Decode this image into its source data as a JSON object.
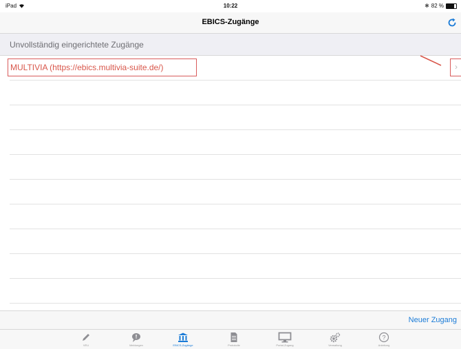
{
  "status_bar": {
    "device": "iPad",
    "time": "10:22",
    "battery": "82 %",
    "battery_level": 0.82
  },
  "nav": {
    "title": "EBICS-Zugänge",
    "refresh_icon": "refresh-icon"
  },
  "section": {
    "header": "Unvollständig eingerichtete Zugänge"
  },
  "rows": [
    {
      "label": "MULTIVIA (https://ebics.multivia-suite.de/)"
    }
  ],
  "toolbar": {
    "new_access": "Neuer Zugang"
  },
  "tabs": [
    {
      "label": "VEU",
      "icon": "pencil-icon"
    },
    {
      "label": "Meldungen",
      "icon": "message-icon"
    },
    {
      "label": "EBICS-Zugänge",
      "icon": "bank-icon",
      "active": true
    },
    {
      "label": "Protokolle",
      "icon": "document-icon"
    },
    {
      "label": "Portal-Zugang",
      "icon": "monitor-icon"
    },
    {
      "label": "Verwaltung",
      "icon": "gears-icon"
    },
    {
      "label": "Anleitung",
      "icon": "help-icon"
    }
  ],
  "colors": {
    "accent": "#1a7bd7",
    "annotation": "#d8564a"
  }
}
